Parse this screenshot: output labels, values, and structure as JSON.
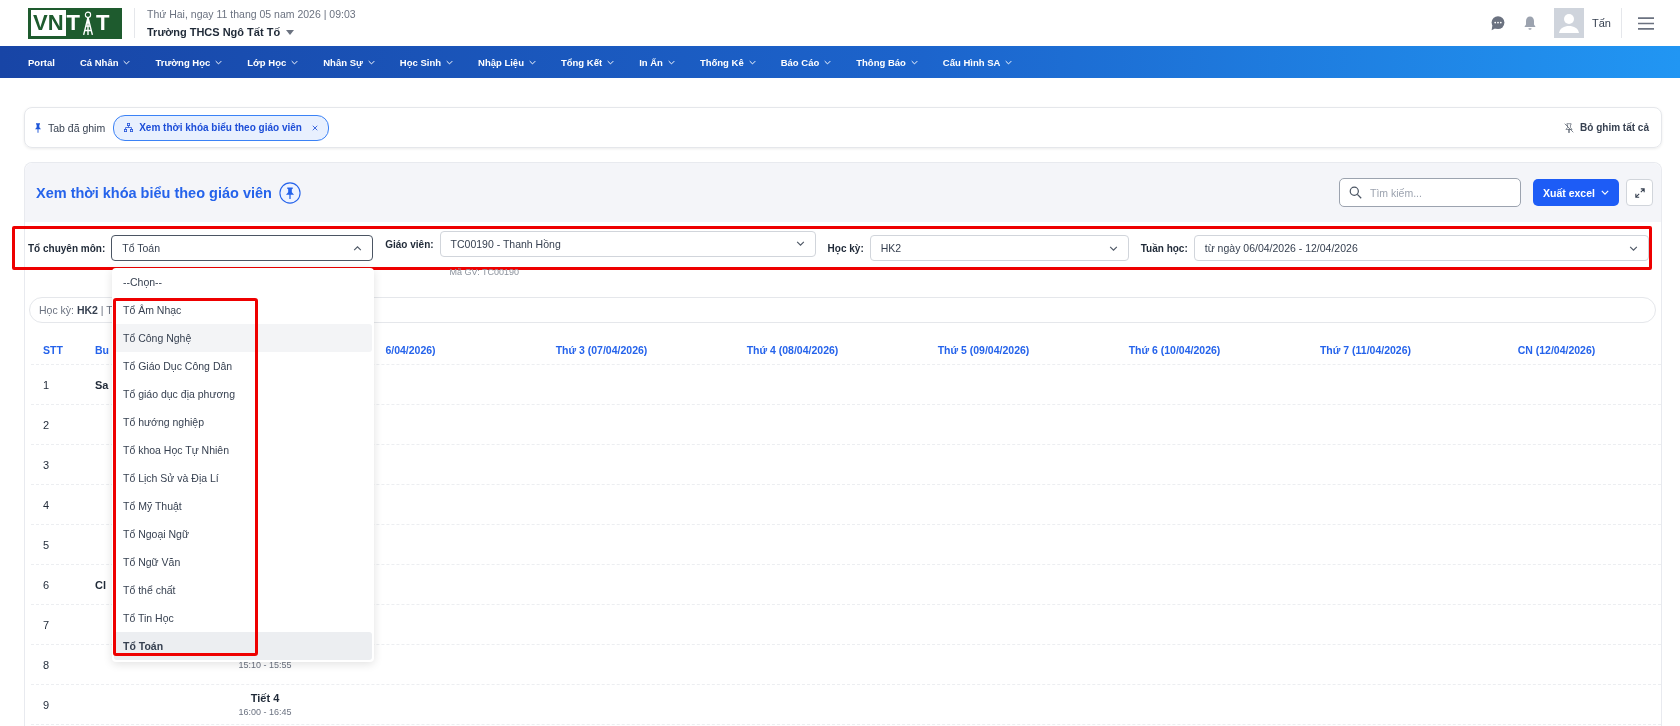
{
  "header": {
    "logo": {
      "parts": [
        "VN",
        "T",
        "T"
      ]
    },
    "date_text": "Thứ Hai, ngay 11 thang 05 nam 2026 | 09:03",
    "school": "Trường THCS Ngô Tất Tố",
    "user_name": "Tấn"
  },
  "nav": [
    {
      "label": "Portal",
      "has_menu": false
    },
    {
      "label": "Cá Nhân",
      "has_menu": true
    },
    {
      "label": "Trường Học",
      "has_menu": true
    },
    {
      "label": "Lớp Học",
      "has_menu": true
    },
    {
      "label": "Nhân Sự",
      "has_menu": true
    },
    {
      "label": "Học Sinh",
      "has_menu": true
    },
    {
      "label": "Nhập Liệu",
      "has_menu": true
    },
    {
      "label": "Tổng Kết",
      "has_menu": true
    },
    {
      "label": "In Ấn",
      "has_menu": true
    },
    {
      "label": "Thống Kê",
      "has_menu": true
    },
    {
      "label": "Báo Cáo",
      "has_menu": true
    },
    {
      "label": "Thông Báo",
      "has_menu": true
    },
    {
      "label": "Cấu Hình SA",
      "has_menu": true
    }
  ],
  "pinned_bar": {
    "label": "Tab đã ghim",
    "tabs": [
      {
        "label": "Xem thời khóa biểu theo giáo viên",
        "selected": true
      }
    ],
    "unpin_all": "Bỏ ghim tất cả"
  },
  "page": {
    "title": "Xem thời khóa biểu theo giáo viên",
    "search": {
      "placeholder": "Tìm kiếm..."
    },
    "export_button": "Xuất excel"
  },
  "filters": [
    {
      "label": "Tổ chuyên môn:",
      "value": "Tổ Toán",
      "open": true
    },
    {
      "label": "Giáo viên:",
      "value": "TC00190 - Thanh Hồng",
      "hint": "Mã GV: TC00190",
      "open": false
    },
    {
      "label": "Học kỳ:",
      "value": "HK2",
      "open": false
    },
    {
      "label": "Tuần học:",
      "value": "từ ngày 06/04/2026 - 12/04/2026",
      "open": false
    }
  ],
  "dropdown": {
    "options": [
      {
        "label": "--Chọn--",
        "hovered": false,
        "selected": false
      },
      {
        "label": "Tổ Âm Nhạc",
        "hovered": false,
        "selected": false
      },
      {
        "label": "Tổ Công Nghệ",
        "hovered": true,
        "selected": false
      },
      {
        "label": "Tổ Giáo Dục Công Dân",
        "hovered": false,
        "selected": false
      },
      {
        "label": "Tổ giáo dục địa phương",
        "hovered": false,
        "selected": false
      },
      {
        "label": "Tổ hướng nghiệp",
        "hovered": false,
        "selected": false
      },
      {
        "label": "Tổ khoa Học Tự Nhiên",
        "hovered": false,
        "selected": false
      },
      {
        "label": "Tổ Lịch Sử và Địa Lí",
        "hovered": false,
        "selected": false
      },
      {
        "label": "Tổ Mỹ Thuật",
        "hovered": false,
        "selected": false
      },
      {
        "label": "Tổ Ngoại Ngữ",
        "hovered": false,
        "selected": false
      },
      {
        "label": "Tổ Ngữ Văn",
        "hovered": false,
        "selected": false
      },
      {
        "label": "Tổ thể chất",
        "hovered": false,
        "selected": false
      },
      {
        "label": "Tổ Tin Học",
        "hovered": false,
        "selected": false
      },
      {
        "label": "Tổ Toán",
        "hovered": false,
        "selected": true
      }
    ]
  },
  "info_bar": "Học kỳ: **HK2** | T",
  "table": {
    "columns": {
      "stt": "STT",
      "session": "Bu",
      "days": [
        "6/04/2026)",
        "Thứ 3 (07/04/2026)",
        "Thứ 4 (08/04/2026)",
        "Thứ 5 (09/04/2026)",
        "Thứ 6 (10/04/2026)",
        "Thứ 7 (11/04/2026)",
        "CN (12/04/2026)"
      ]
    },
    "rows": [
      {
        "stt": "1",
        "session": "Sa"
      },
      {
        "stt": "2"
      },
      {
        "stt": "3"
      },
      {
        "stt": "4"
      },
      {
        "stt": "5"
      },
      {
        "stt": "6",
        "session": "Cl"
      },
      {
        "stt": "7"
      },
      {
        "stt": "8",
        "time": "15:10 - 15:55"
      },
      {
        "stt": "9",
        "period": "Tiết 4",
        "time": "16:00 - 16:45"
      }
    ]
  }
}
